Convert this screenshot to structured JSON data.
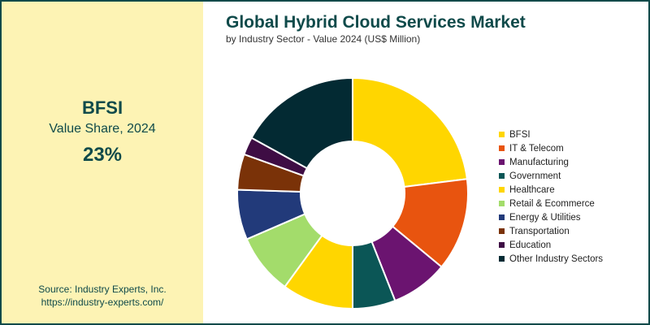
{
  "highlight": {
    "name": "BFSI",
    "metric": "Value Share, 2024",
    "value": "23%"
  },
  "source": {
    "line1": "Source: Industry Experts, Inc.",
    "line2": "https://industry-experts.com/"
  },
  "colors": {
    "panel_bg": "#fdf3b4",
    "accent": "#0f4a4a"
  },
  "chart_data": {
    "type": "pie",
    "style": "donut",
    "title": "Global Hybrid Cloud Services Market",
    "subtitle": "by Industry Sector - Value 2024 (US$ Million)",
    "legend_position": "right",
    "series": [
      {
        "name": "BFSI",
        "value": 23,
        "color": "#ffd600"
      },
      {
        "name": "IT & Telecom",
        "value": 13,
        "color": "#e8540f"
      },
      {
        "name": "Manufacturing",
        "value": 8,
        "color": "#6b1470"
      },
      {
        "name": "Government",
        "value": 6,
        "color": "#0b5656"
      },
      {
        "name": "Healthcare",
        "value": 10,
        "color": "#ffd600"
      },
      {
        "name": "Retail & Ecommerce",
        "value": 8.5,
        "color": "#a3dc6b"
      },
      {
        "name": "Energy & Utilities",
        "value": 7,
        "color": "#223a7a"
      },
      {
        "name": "Transportation",
        "value": 5,
        "color": "#7a3208"
      },
      {
        "name": "Education",
        "value": 2.5,
        "color": "#3e0d44"
      },
      {
        "name": "Other Industry Sectors",
        "value": 17,
        "color": "#032a33"
      }
    ]
  }
}
